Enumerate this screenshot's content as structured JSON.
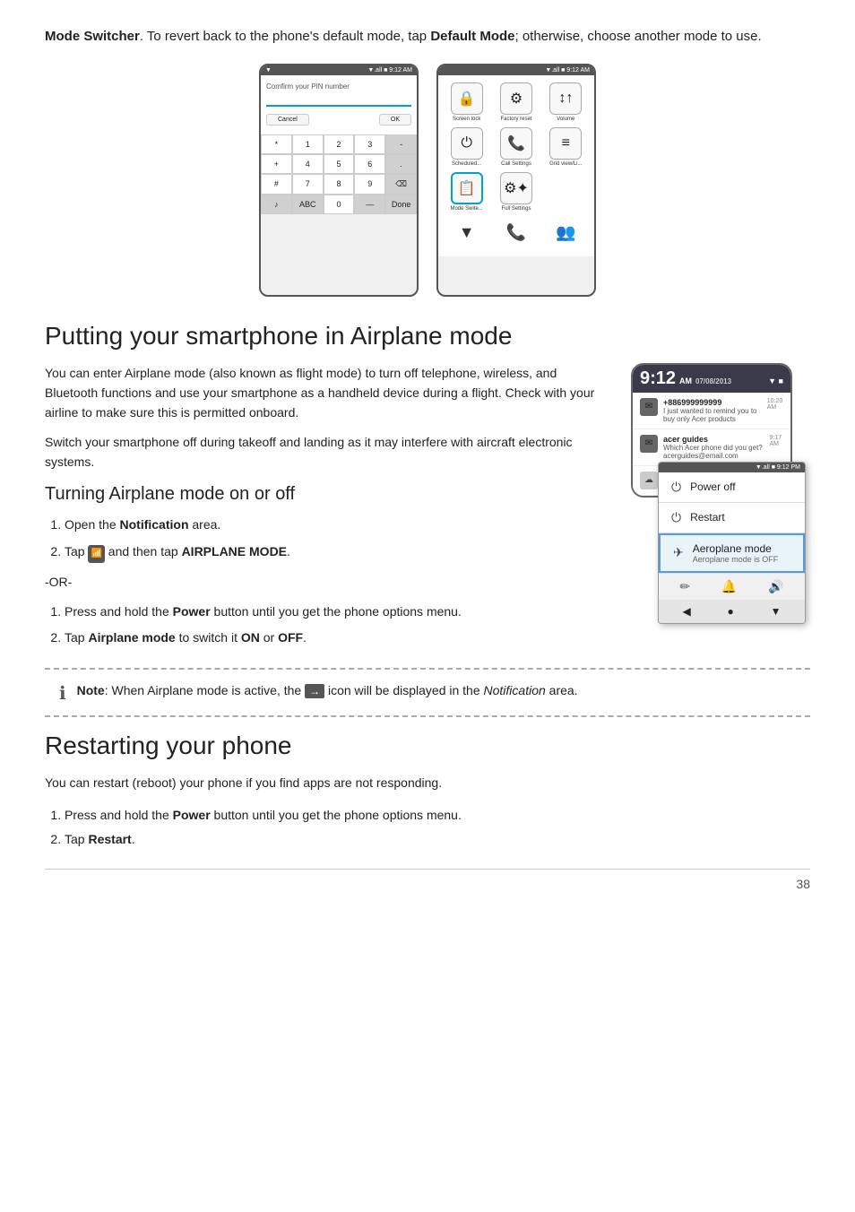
{
  "intro": {
    "text_before": "Mode Switcher",
    "text_after": ". To revert back to the phone's default mode, tap ",
    "default_mode": "Default Mode",
    "text_end": "; otherwise, choose another mode to use."
  },
  "phone_left": {
    "status_left": "▼",
    "status_right": "▼.all ■ 9:12 AM",
    "pin_label": "Comfirm your PIN number",
    "cancel_btn": "Cancel",
    "ok_btn": "OK",
    "keys": [
      [
        "*",
        "1",
        "2",
        "3",
        "-"
      ],
      [
        "+",
        "4",
        "5",
        "6",
        "."
      ],
      [
        "#",
        "7",
        "8",
        "9",
        "⌫"
      ],
      [
        "🎵",
        "ABC",
        "0",
        "—",
        "Done"
      ]
    ]
  },
  "phone_right": {
    "status_right": "▼.all ■ 9:12 AM",
    "grid_items": [
      {
        "icon": "🔒",
        "label": "Screen lock",
        "highlight": false
      },
      {
        "icon": "⚙",
        "label": "Factory reset",
        "highlight": false
      },
      {
        "icon": "↕",
        "label": "Volume",
        "highlight": false
      },
      {
        "icon": "⏻",
        "label": "Scheduled...",
        "highlight": false
      },
      {
        "icon": "📞",
        "label": "Call Settings",
        "highlight": false
      },
      {
        "icon": "≡",
        "label": "Grid view/Li...",
        "highlight": false
      },
      {
        "icon": "📋",
        "label": "Mode Swite...",
        "highlight": true
      },
      {
        "icon": "⚙✦",
        "label": "Full Settings",
        "highlight": false
      }
    ],
    "bottom_icons": [
      "▼",
      "📞",
      "👥"
    ]
  },
  "section1": {
    "heading": "Putting your smartphone in Airplane mode",
    "para1": "You can enter Airplane mode (also known as flight mode) to turn off telephone, wireless, and Bluetooth functions and use your smartphone as a handheld device during a flight. Check with your airline to make sure this is permitted onboard.",
    "para2": "Switch your smartphone off during takeoff and landing as it may interfere with aircraft electronic systems.",
    "sub_heading": "Turning Airplane mode on or off",
    "steps_1": [
      {
        "num": 1,
        "text": "Open the ",
        "bold": "Notification",
        "text2": " area."
      },
      {
        "num": 2,
        "text": "Tap ",
        "icon": true,
        "text2": " and then tap ",
        "bold2": "AIRPLANE MODE",
        "text3": "."
      }
    ],
    "or_text": "-OR-",
    "steps_2": [
      {
        "num": 1,
        "text": "Press and hold the ",
        "bold": "Power",
        "text2": " button until you get the phone options menu."
      },
      {
        "num": 2,
        "text": "Tap ",
        "bold": "Airplane mode",
        "text2": " to switch it ",
        "bold2": "ON",
        "text3": " or ",
        "bold3": "OFF",
        "text4": "."
      }
    ]
  },
  "phone_airplane": {
    "time": "9:12",
    "ampm": "AM",
    "date": "07/08/2013",
    "notif_items": [
      {
        "icon": "✉",
        "sender": "+886999999999",
        "msg": "I just wanted to remind you to buy only Acer products",
        "time": "10:20 AM"
      },
      {
        "icon": "✉",
        "sender": "acer guides",
        "msg": "Which Acer phone did you get? acerguides@email.com",
        "time": "9:17 AM"
      }
    ],
    "popup": {
      "status": "▼.all ■ 9:12 PM",
      "items": [
        {
          "icon": "⏻",
          "label": "Power off"
        },
        {
          "icon": "⏻",
          "label": "Restart"
        },
        {
          "icon": "✈",
          "label": "Aeroplane mode",
          "sublabel": "Aeroplane mode is OFF",
          "highlighted": true
        }
      ],
      "bottom_icons": [
        "✏",
        "🔔",
        "🔊"
      ],
      "nav_icons": [
        "◀",
        "●",
        "▼"
      ]
    }
  },
  "note": {
    "icon": "ℹ",
    "text_before": "Note",
    "text_colon": ": When Airplane mode is active, the ",
    "arrow_icon": "→",
    "text_after": " icon will be displayed in the ",
    "italic": "Notification",
    "text_end": " area."
  },
  "section2": {
    "heading": "Restarting your phone",
    "para": "You can restart (reboot) your phone if you find apps are not responding.",
    "steps": [
      {
        "num": 1,
        "text": "Press and hold the ",
        "bold": "Power",
        "text2": " button until you get the phone options menu."
      },
      {
        "num": 2,
        "text": "Tap ",
        "bold": "Restart",
        "text2": "."
      }
    ]
  },
  "page_number": "38"
}
